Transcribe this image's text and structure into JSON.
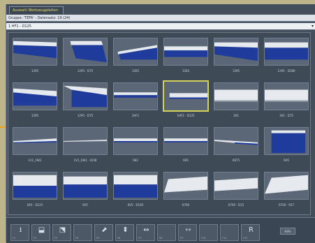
{
  "window_tab": "Auswahl Werkzeugplatten",
  "group_line": "Gruppe: 'TEFA' - Datensatz: 19 (24)",
  "selection_value": "1 HF1 - D125",
  "tiles": [
    {
      "label": "1295",
      "shape": "wedge-down"
    },
    {
      "label": "1295 - D75",
      "shape": "wedge-steep"
    },
    {
      "label": "1265",
      "shape": "low-wedge"
    },
    {
      "label": "1263",
      "shape": "mid-bar"
    },
    {
      "label": "1295",
      "shape": "wide-wedge"
    },
    {
      "label": "1295 - D180",
      "shape": "wide-bar"
    },
    {
      "label": "1295",
      "shape": "slope"
    },
    {
      "label": "1295 - D75",
      "shape": "slope-deep"
    },
    {
      "label": "1HF1",
      "shape": "thin-blue"
    },
    {
      "label": "1HF1 - D125",
      "shape": "thin-white"
    },
    {
      "label": "1K1",
      "shape": "flat-bar"
    },
    {
      "label": "1K1 - D75",
      "shape": "flat-bar"
    },
    {
      "label": "1V1_1N/1",
      "shape": "sliver"
    },
    {
      "label": "1V1_1N/1 - D/38",
      "shape": "sliver-thin"
    },
    {
      "label": "662",
      "shape": "thin-line"
    },
    {
      "label": "665",
      "shape": "thin-line"
    },
    {
      "label": "6675",
      "shape": "sliver-tail"
    },
    {
      "label": "6A5",
      "shape": "tall-block"
    },
    {
      "label": "6A5 - D125",
      "shape": "half-block"
    },
    {
      "label": "6V5",
      "shape": "half-block-gray"
    },
    {
      "label": "6V5 - D195",
      "shape": "half-block-full"
    },
    {
      "label": "6700",
      "shape": "white-plate"
    },
    {
      "label": "6700 - D15",
      "shape": "white-plate-flat"
    },
    {
      "label": "6700 - 657",
      "shape": "white-plate-slope"
    }
  ],
  "selected_index": 9,
  "toolbar": [
    {
      "key": "F1",
      "glyph": "⭳"
    },
    {
      "key": "F2",
      "glyph": "⬓"
    },
    {
      "key": "F3",
      "glyph": "⬔"
    },
    {
      "key": "F4",
      "glyph": ""
    },
    {
      "key": "F5",
      "glyph": "⬈"
    },
    {
      "key": "F6",
      "glyph": "⬍"
    },
    {
      "key": "F7",
      "glyph": "⇔"
    },
    {
      "key": "F8",
      "glyph": ""
    },
    {
      "key": "F9",
      "glyph": "⇿"
    },
    {
      "key": "F10",
      "glyph": ""
    },
    {
      "key": "F11",
      "glyph": ""
    },
    {
      "key": "F12",
      "glyph": "R"
    }
  ],
  "help_label": "Hilfe",
  "colors": {
    "blue": "#1f3c9c",
    "light": "#e6eaef",
    "selected": "#d4d15a"
  }
}
